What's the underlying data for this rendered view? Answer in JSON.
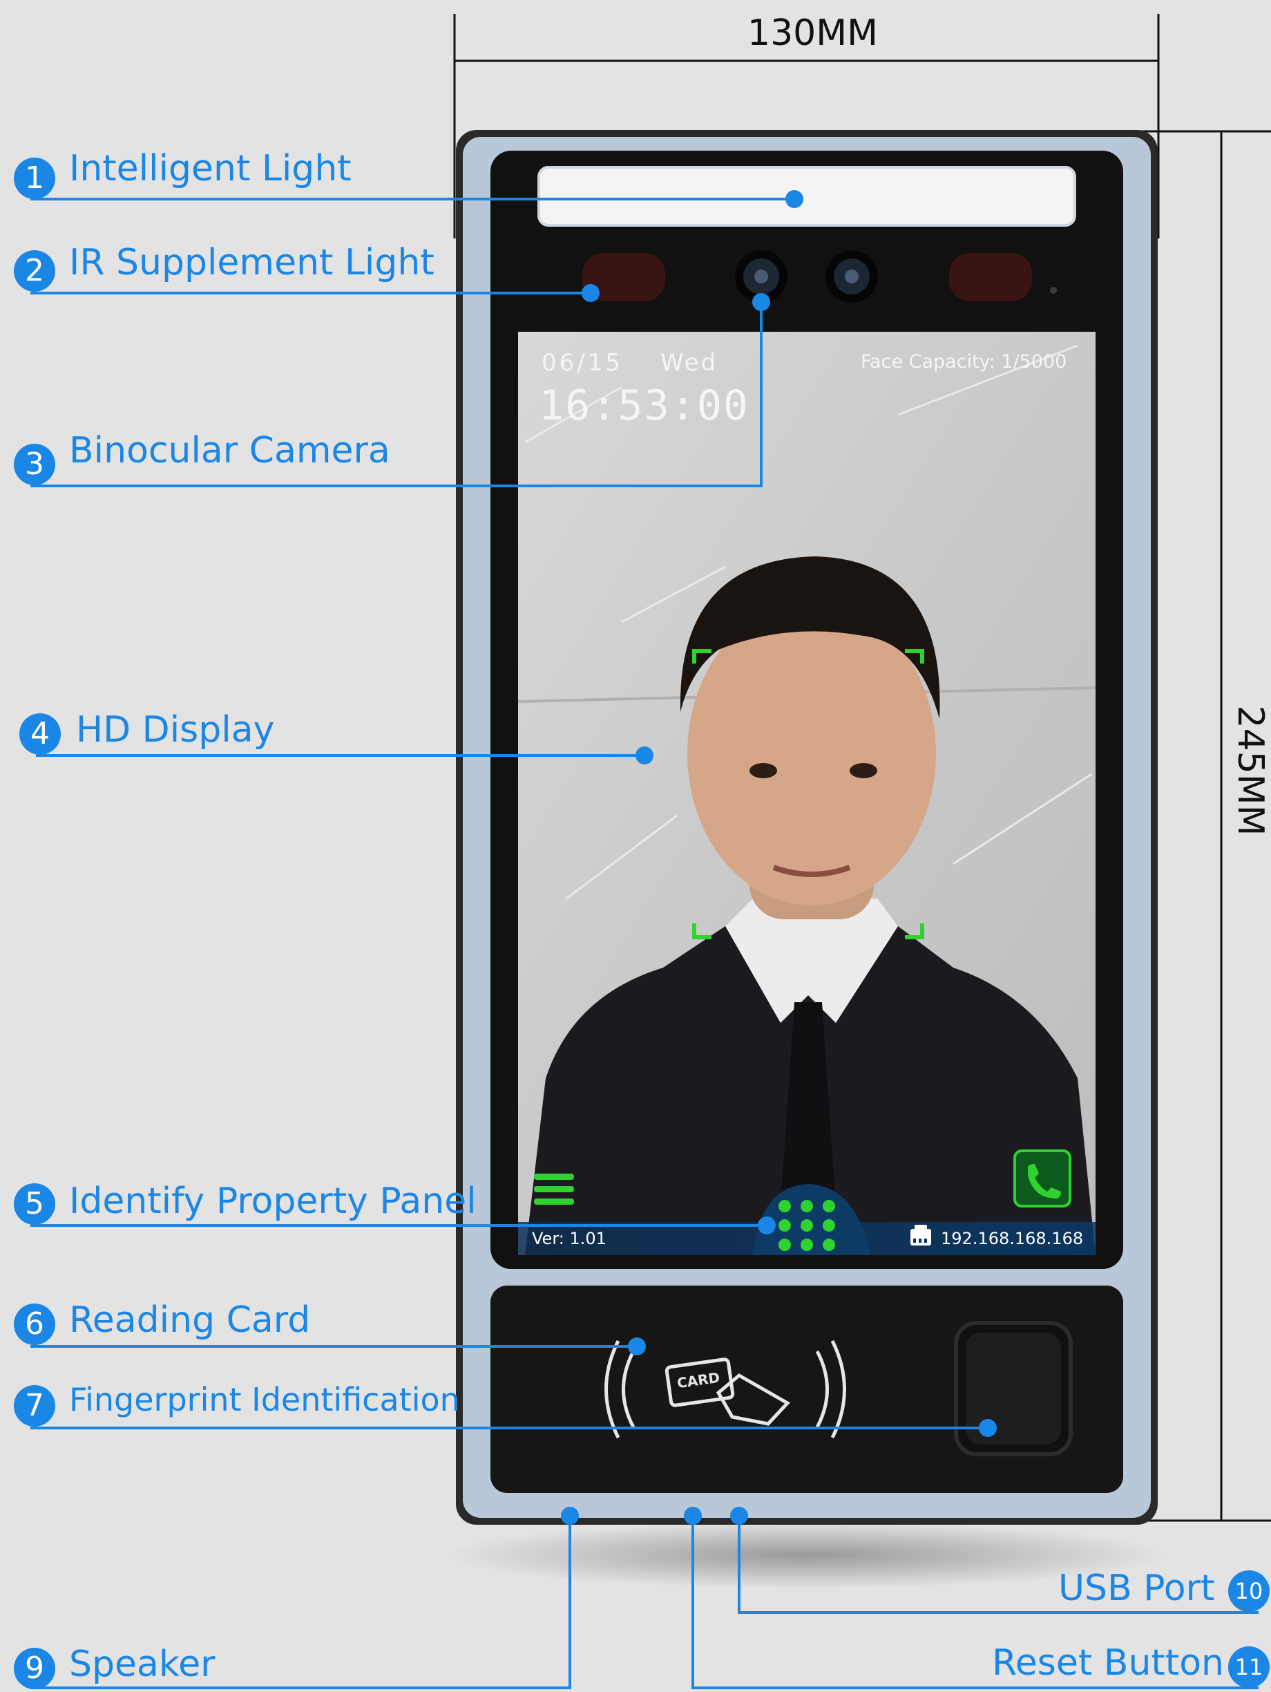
{
  "dimensions": {
    "width": "130MM",
    "height": "245MM"
  },
  "callouts": [
    {
      "num": "1",
      "label": "Intelligent Light"
    },
    {
      "num": "2",
      "label": "IR Supplement Light"
    },
    {
      "num": "3",
      "label": "Binocular Camera"
    },
    {
      "num": "4",
      "label": "HD Display"
    },
    {
      "num": "5",
      "label": "Identify Property Panel"
    },
    {
      "num": "6",
      "label": "Reading Card"
    },
    {
      "num": "7",
      "label": "Fingerprint Identification"
    },
    {
      "num": "9",
      "label": "Speaker"
    },
    {
      "num": "10",
      "label": "USB Port"
    },
    {
      "num": "11",
      "label": "Reset Button"
    }
  ],
  "screen": {
    "date": "06/15",
    "weekday": "Wed",
    "time": "16:53:00",
    "capacity": "Face Capacity: 1/5000",
    "version": "Ver: 1.01",
    "ip": "192.168.168.168"
  },
  "card_reader": {
    "text": "CARD"
  },
  "colors": {
    "accent": "#1a86e6",
    "face_frame": "#2fd32f",
    "background": "#e3e3e3"
  },
  "icons": [
    "menu-icon",
    "phone-icon",
    "keypad-icon",
    "network-icon",
    "card-icon",
    "fingerprint-sensor-icon"
  ]
}
